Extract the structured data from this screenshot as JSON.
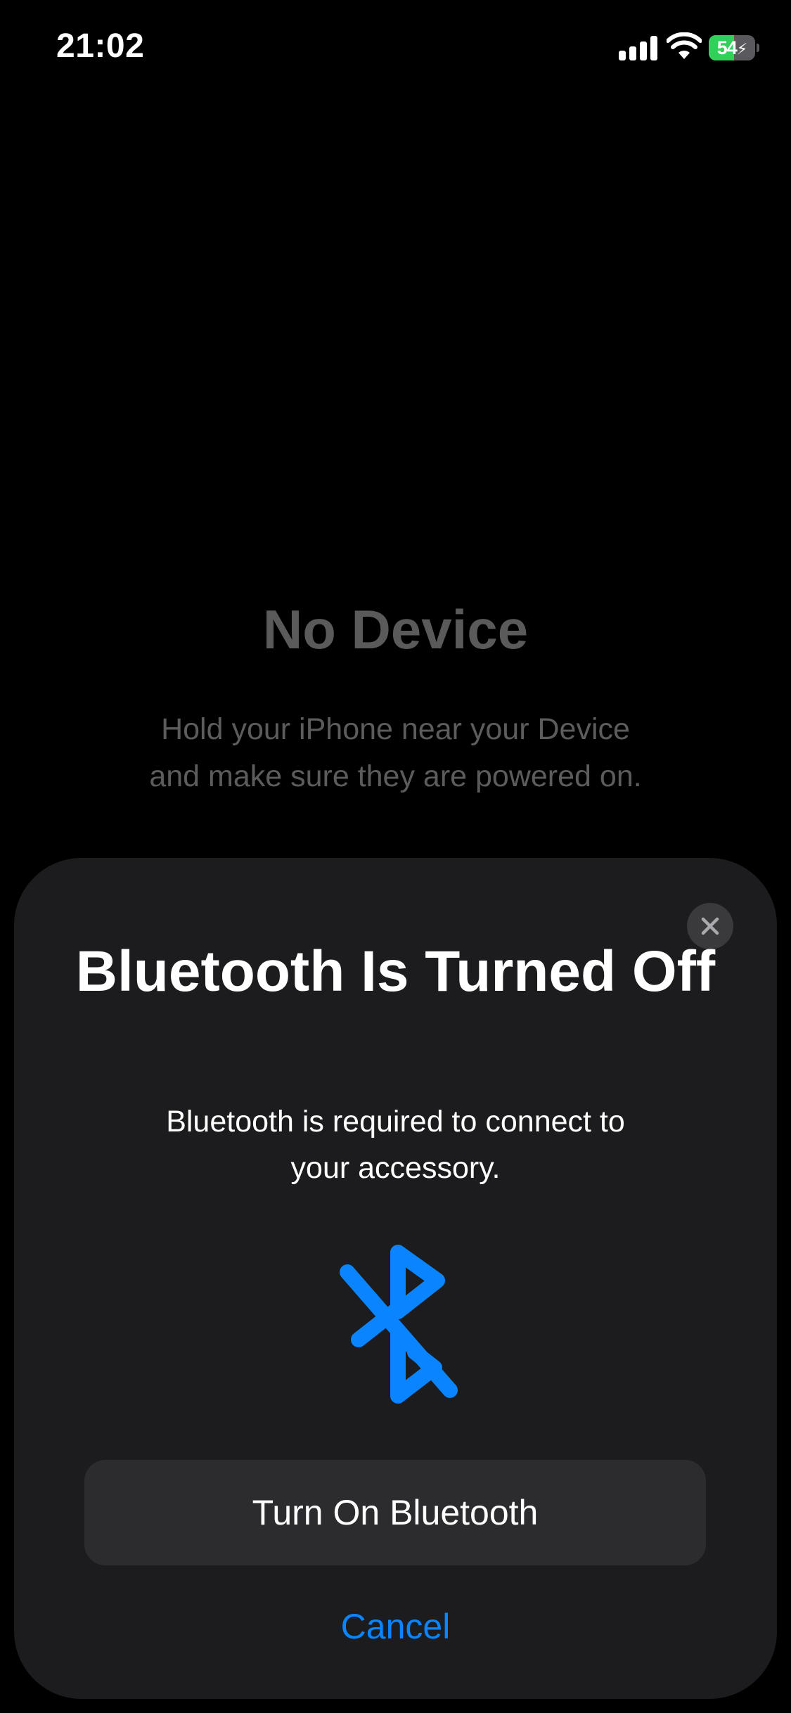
{
  "status_bar": {
    "time": "21:02",
    "battery_percent": "54",
    "battery_level": 0.54,
    "battery_charging": true,
    "icons": [
      "cellular-signal-icon",
      "wifi-icon",
      "battery-icon",
      "charging-bolt-icon"
    ]
  },
  "background": {
    "title": "No Device",
    "message": "Hold your iPhone near your Device and make sure they are powered on."
  },
  "sheet": {
    "title": "Bluetooth Is Turned Off",
    "message": "Bluetooth is required to connect to your accessory.",
    "icon": "bluetooth-off-icon",
    "primary_button": "Turn On Bluetooth",
    "cancel_label": "Cancel",
    "close_icon": "close-icon"
  },
  "colors": {
    "accent": "#0a84ff",
    "sheet_background": "#1c1c1e",
    "button_background": "#2c2c2e",
    "battery_green": "#30d158",
    "dimmed_text": "#5a5a5a"
  }
}
